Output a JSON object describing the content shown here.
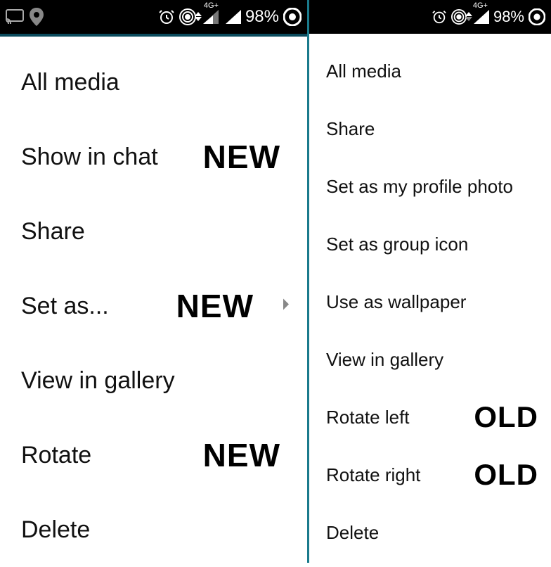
{
  "status": {
    "network_label": "4G+",
    "battery": "98%"
  },
  "left": {
    "menu": [
      {
        "label": "All media",
        "annotation": ""
      },
      {
        "label": "Show in chat",
        "annotation": "NEW"
      },
      {
        "label": "Share",
        "annotation": ""
      },
      {
        "label": "Set as...",
        "annotation": "NEW",
        "has_chevron": true
      },
      {
        "label": "View in gallery",
        "annotation": ""
      },
      {
        "label": "Rotate",
        "annotation": "NEW"
      },
      {
        "label": "Delete",
        "annotation": ""
      }
    ]
  },
  "right": {
    "menu": [
      {
        "label": "All media",
        "annotation": ""
      },
      {
        "label": "Share",
        "annotation": ""
      },
      {
        "label": "Set as my profile photo",
        "annotation": ""
      },
      {
        "label": "Set as group icon",
        "annotation": ""
      },
      {
        "label": "Use as wallpaper",
        "annotation": ""
      },
      {
        "label": "View in gallery",
        "annotation": ""
      },
      {
        "label": "Rotate left",
        "annotation": "OLD"
      },
      {
        "label": "Rotate right",
        "annotation": "OLD"
      },
      {
        "label": "Delete",
        "annotation": ""
      }
    ]
  }
}
